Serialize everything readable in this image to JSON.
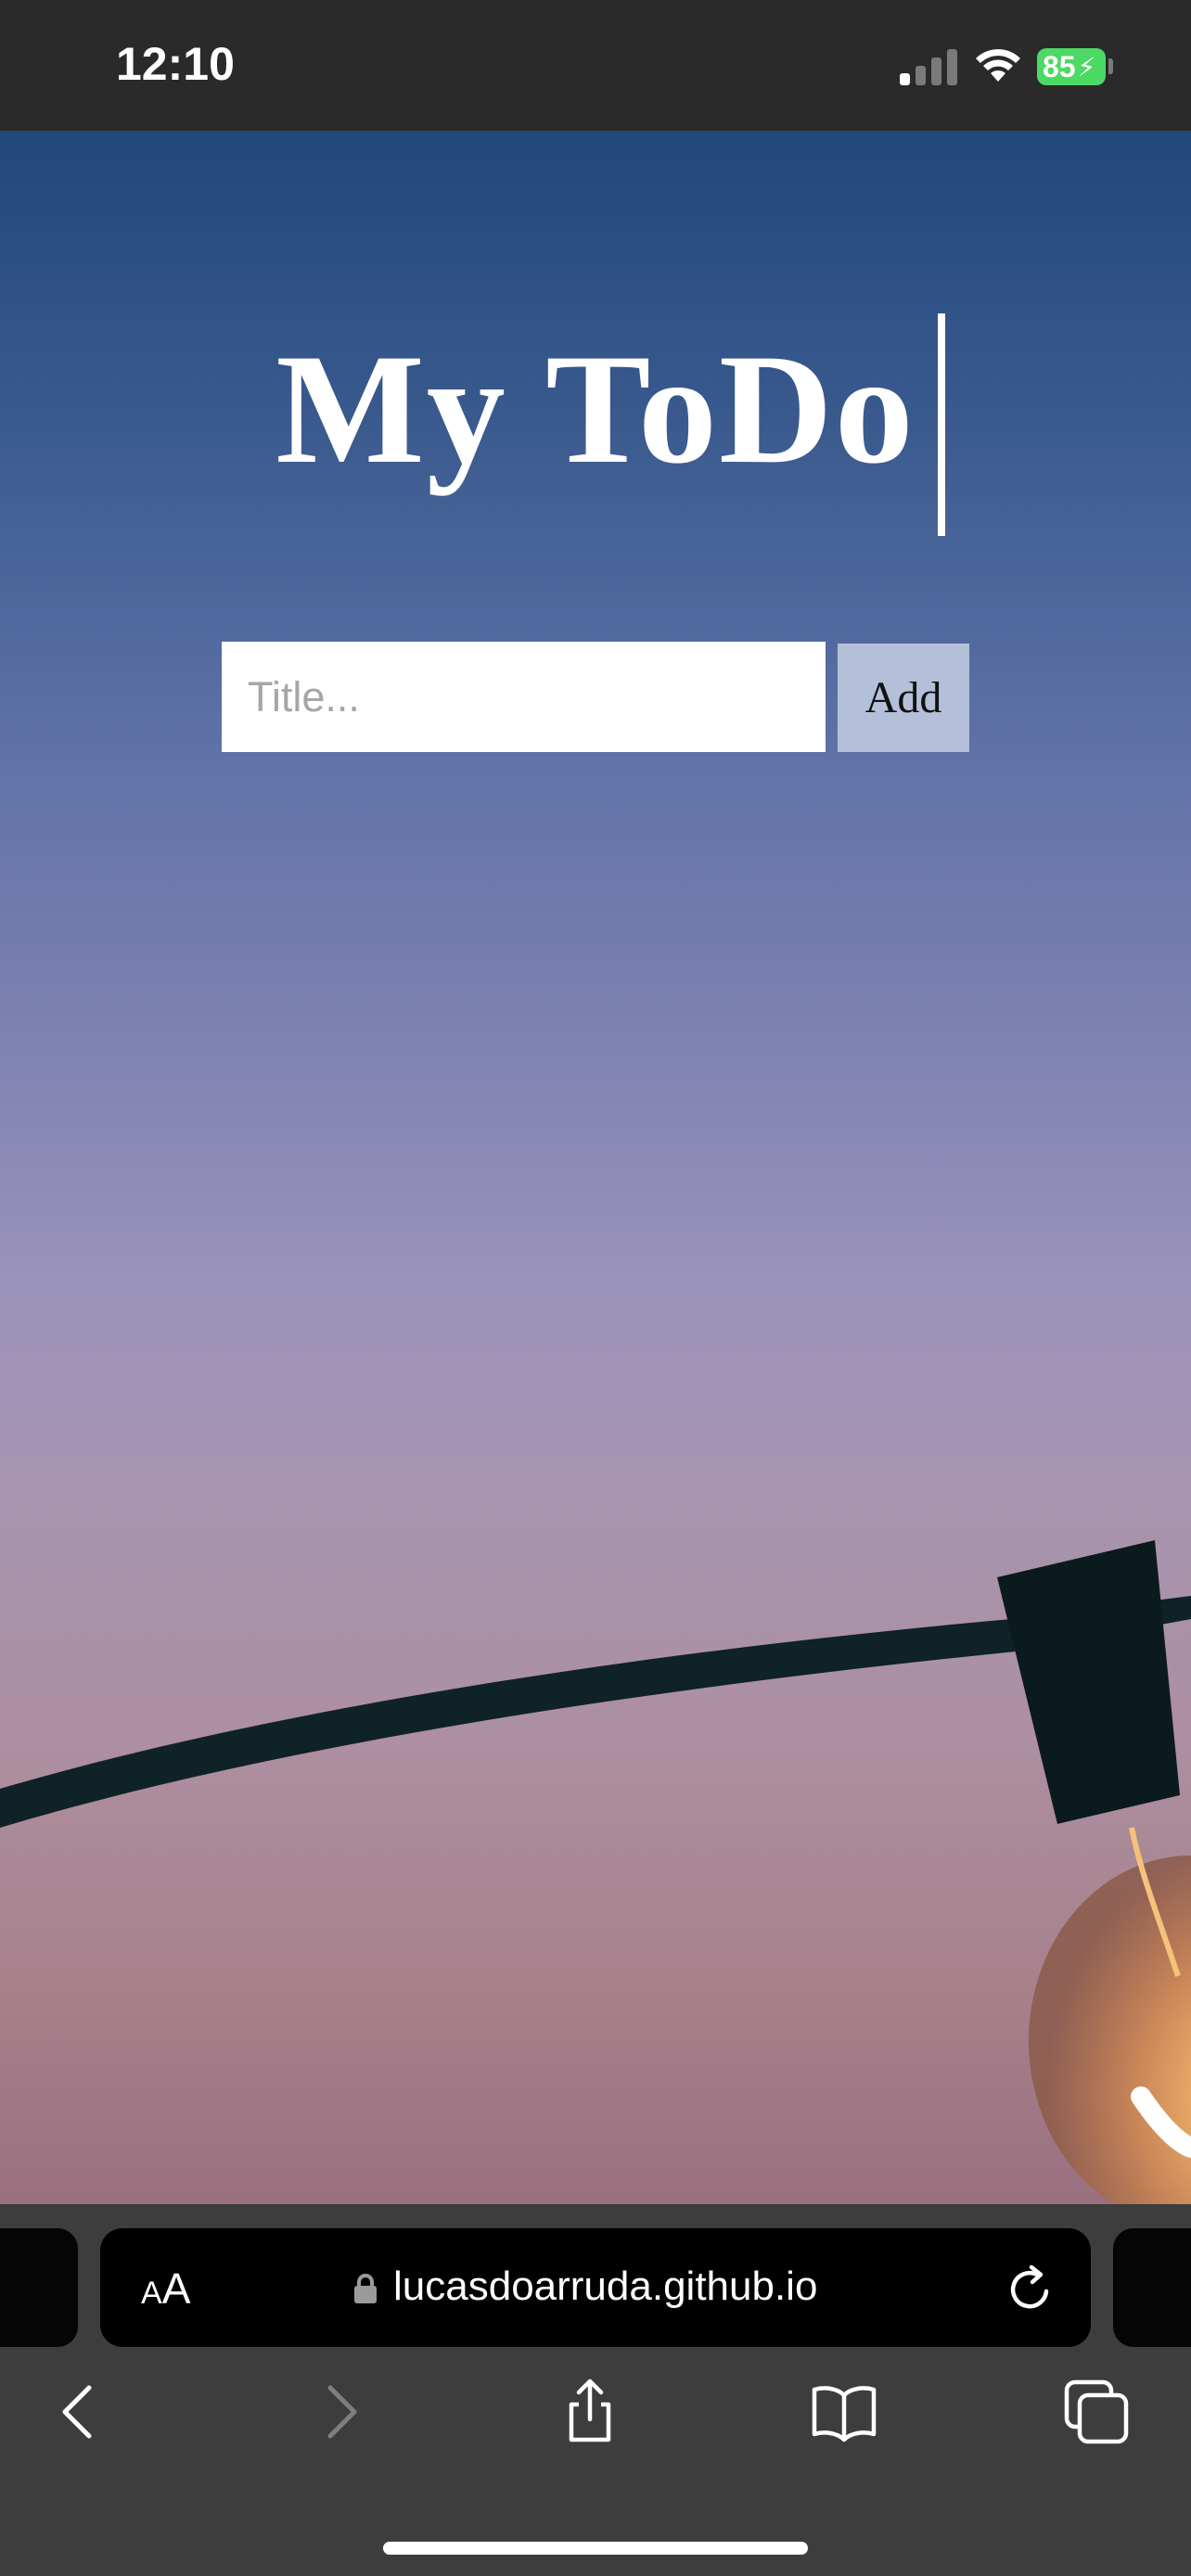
{
  "status_bar": {
    "time": "12:10",
    "battery_level": "85"
  },
  "app": {
    "title": "My ToDo",
    "input": {
      "placeholder": "Title...",
      "value": ""
    },
    "add_label": "Add"
  },
  "browser": {
    "text_size_label_small": "A",
    "text_size_label_big": "A",
    "url": "lucasdoarruda.github.io",
    "icons": [
      "lock-icon",
      "reload-icon",
      "back-icon",
      "forward-icon",
      "share-icon",
      "bookmarks-icon",
      "tabs-icon"
    ]
  },
  "colors": {
    "battery": "#4cd964",
    "add_button": "#b4c0d9",
    "sky_top": "#22477a",
    "sky_bottom": "#9a7080"
  }
}
